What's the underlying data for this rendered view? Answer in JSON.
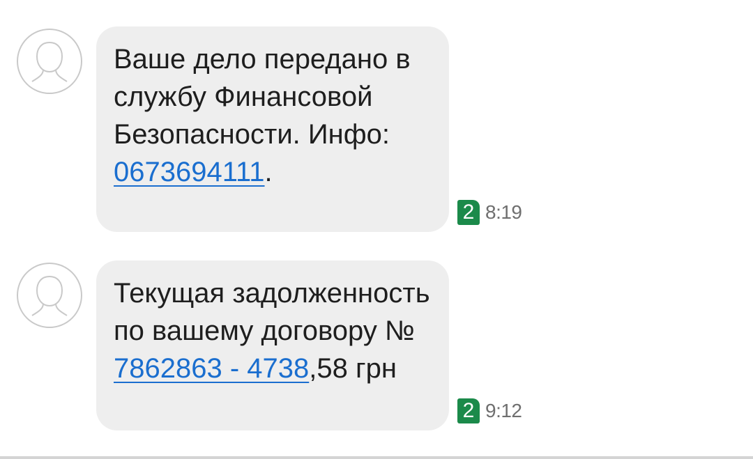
{
  "messages": [
    {
      "text_before": "Ваше дело передано в службу Финансовой Безопасности. Инфо: ",
      "link": "0673694111",
      "text_after": ".",
      "sim": "2",
      "time": "8:19"
    },
    {
      "text_before": "Текущая задолженность по вашему договору № ",
      "link": "7862863 - 4738",
      "text_after": ",58 грн",
      "sim": "2",
      "time": "9:12"
    }
  ],
  "icons": {
    "avatar": "person-outline-icon",
    "sim": "sim-2-badge"
  },
  "colors": {
    "bubble": "#eeeeee",
    "link": "#1a6ecf",
    "sim_badge": "#1b8a4a",
    "time": "#6f6f6f"
  }
}
